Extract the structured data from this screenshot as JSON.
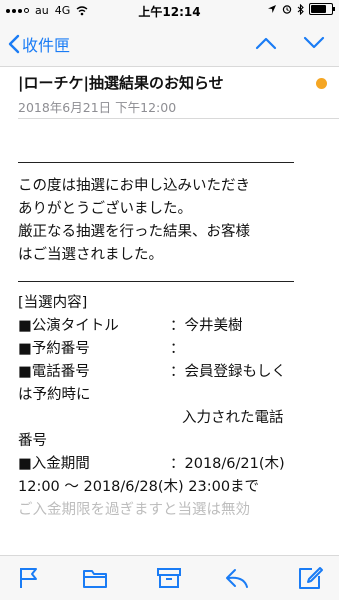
{
  "status_bar": {
    "carrier": "au",
    "network": "4G",
    "time": "上午12:14"
  },
  "nav": {
    "back_label": "收件匣"
  },
  "message": {
    "subject": "|ローチケ|抽選結果のお知らせ",
    "date": "2018年6月21日 下午12:00",
    "flag_color": "#f5a623",
    "lines": [
      "この度は抽選にお申し込みいただき",
      "ありがとうございました。",
      "厳正なる抽選を行った結果、お客様",
      "はご当選されました。"
    ],
    "section_header": "[当選内容]",
    "details": [
      {
        "label": "■公演タイトル",
        "value": "：今井美樹"
      },
      {
        "label": "■予約番号",
        "value": "："
      },
      {
        "label": "■電話番号",
        "value": "：会員登録もしく"
      }
    ],
    "phone_cont1": "は予約時に",
    "phone_cont2": "入力された電話",
    "phone_cont3": "番号",
    "payment_label": "■入金期間",
    "payment_value": "：2018/6/21(木)",
    "payment_cont": "12:00 ～ 2018/6/28(木) 23:00まで",
    "faded_line": "ご入金期限を過ぎますと当選は無効"
  },
  "colors": {
    "accent": "#1a7cf5",
    "toolbar_icon": "#1a7cf5"
  },
  "toolbar": {
    "icons": [
      "flag-icon",
      "folder-icon",
      "archive-icon",
      "reply-icon",
      "compose-icon"
    ]
  }
}
